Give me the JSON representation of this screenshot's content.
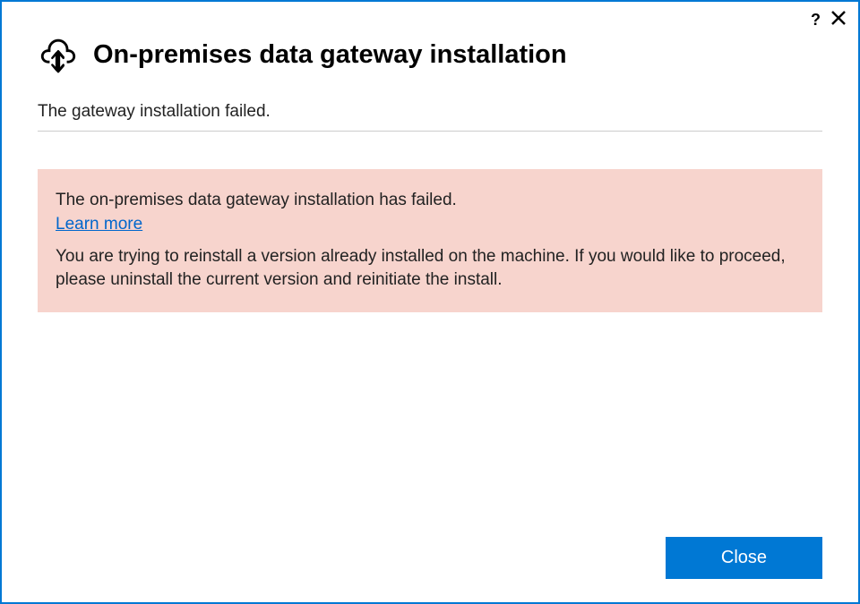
{
  "titlebar": {
    "help_label": "?",
    "close_label": ""
  },
  "header": {
    "title": "On-premises data gateway installation"
  },
  "status": {
    "message": "The gateway installation failed."
  },
  "error": {
    "headline": "The on-premises data gateway installation has failed.",
    "learn_more_label": "Learn more",
    "detail": "You are trying to reinstall a version already installed on the machine. If you would like to proceed, please uninstall the current version and reinitiate the install."
  },
  "footer": {
    "close_button_label": "Close"
  }
}
